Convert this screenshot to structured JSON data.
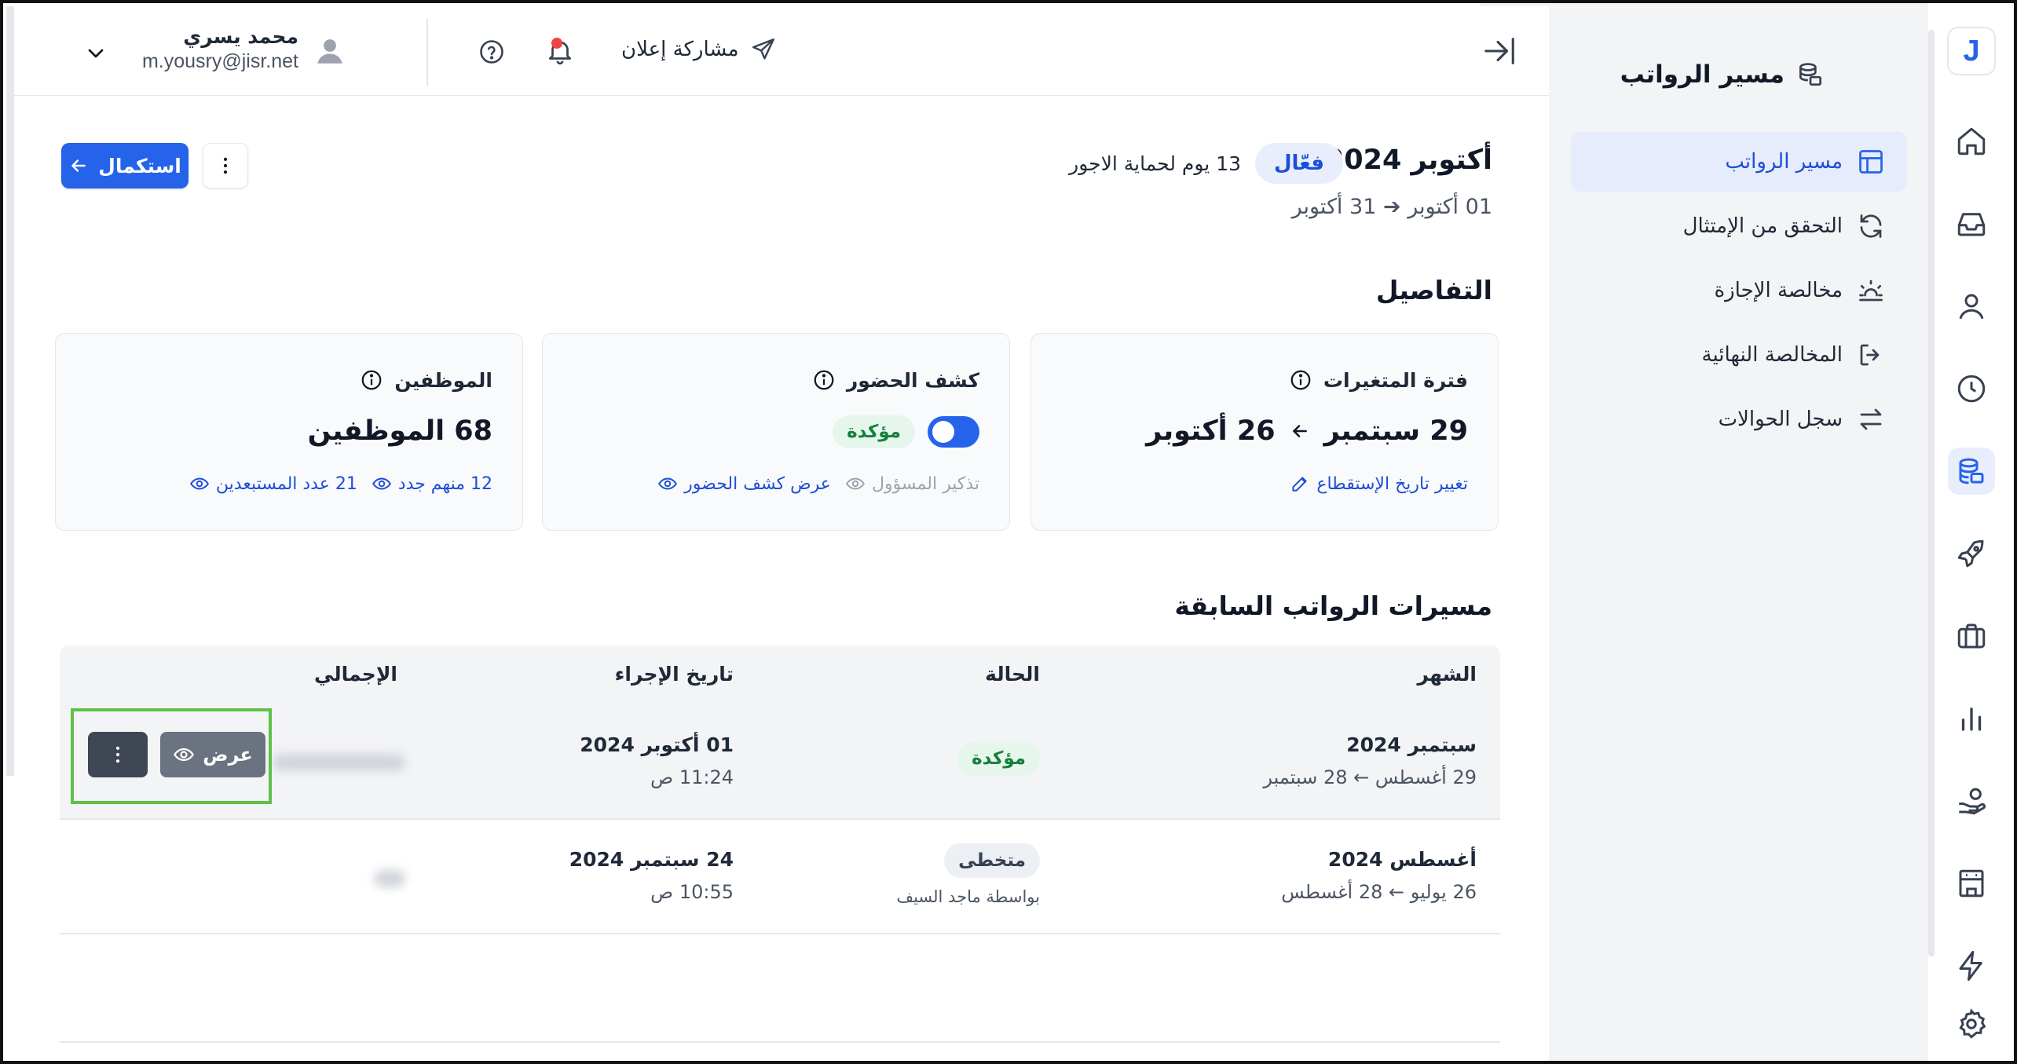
{
  "header": {
    "share_label": "مشاركة إعلان",
    "user_name": "محمد يسري",
    "user_email": "m.yousry@jisr.net"
  },
  "sidebar": {
    "title": "مسير الرواتب",
    "items": [
      {
        "label": "مسير الرواتب",
        "icon": "table-icon",
        "active": true
      },
      {
        "label": "التحقق من الإمتثال",
        "icon": "refresh-icon",
        "active": false
      },
      {
        "label": "مخالصة الإجازة",
        "icon": "sunset-icon",
        "active": false
      },
      {
        "label": "المخالصة النهائية",
        "icon": "logout-icon",
        "active": false
      },
      {
        "label": "سجل الحوالات",
        "icon": "transfer-icon",
        "active": false
      }
    ]
  },
  "rail": {
    "logo": "J",
    "icons": [
      "home-icon",
      "inbox-icon",
      "user-icon",
      "clock-icon",
      "coins-icon",
      "rocket-icon",
      "briefcase-icon",
      "chart-icon",
      "hand-coin-icon",
      "building-icon",
      "bolt-icon",
      "settings-icon"
    ]
  },
  "period": {
    "title": "أكتوبر 2024",
    "status": "فعّال",
    "protection": "13 يوم لحماية الاجور",
    "range_start": "01 أكتوبر",
    "range_end": "31 أكتوبر",
    "complete_label": "استكمال"
  },
  "details": {
    "title": "التفاصيل",
    "variables_card": {
      "title": "فترة المتغيرات",
      "from": "29 سبتمبر",
      "to": "26 أكتوبر",
      "link": "تغيير تاريخ الإستقطاع"
    },
    "attendance_card": {
      "title": "كشف الحضور",
      "status": "مؤكدة",
      "remind_link": "تذكير المسؤول",
      "view_link": "عرض كشف الحضور"
    },
    "employees_card": {
      "title": "الموظفين",
      "value": "68 الموظفين",
      "new_link": "12 منهم جدد",
      "excluded_link": "21 عدد المستبعدين"
    }
  },
  "history": {
    "title": "مسيرات الرواتب السابقة",
    "columns": {
      "month": "الشهر",
      "status": "الحالة",
      "date": "تاريخ الإجراء",
      "total": "الإجمالي"
    },
    "rows": [
      {
        "month": "سبتمبر 2024",
        "from": "29 أغسطس",
        "to": "28 سبتمبر",
        "status": "مؤكدة",
        "status_note": "",
        "date": "01 أكتوبر 2024",
        "time": "11:24 ص"
      },
      {
        "month": "أغسطس 2024",
        "from": "26 يوليو",
        "to": "28 أغسطس",
        "status": "متخطى",
        "status_note": "بواسطة ماجد السيف",
        "date": "24 سبتمبر 2024",
        "time": "10:55 ص"
      }
    ],
    "view_label": "عرض"
  },
  "colors": {
    "accent": "#2563eb",
    "success": "#15803d",
    "highlight": "#5fc14a"
  }
}
